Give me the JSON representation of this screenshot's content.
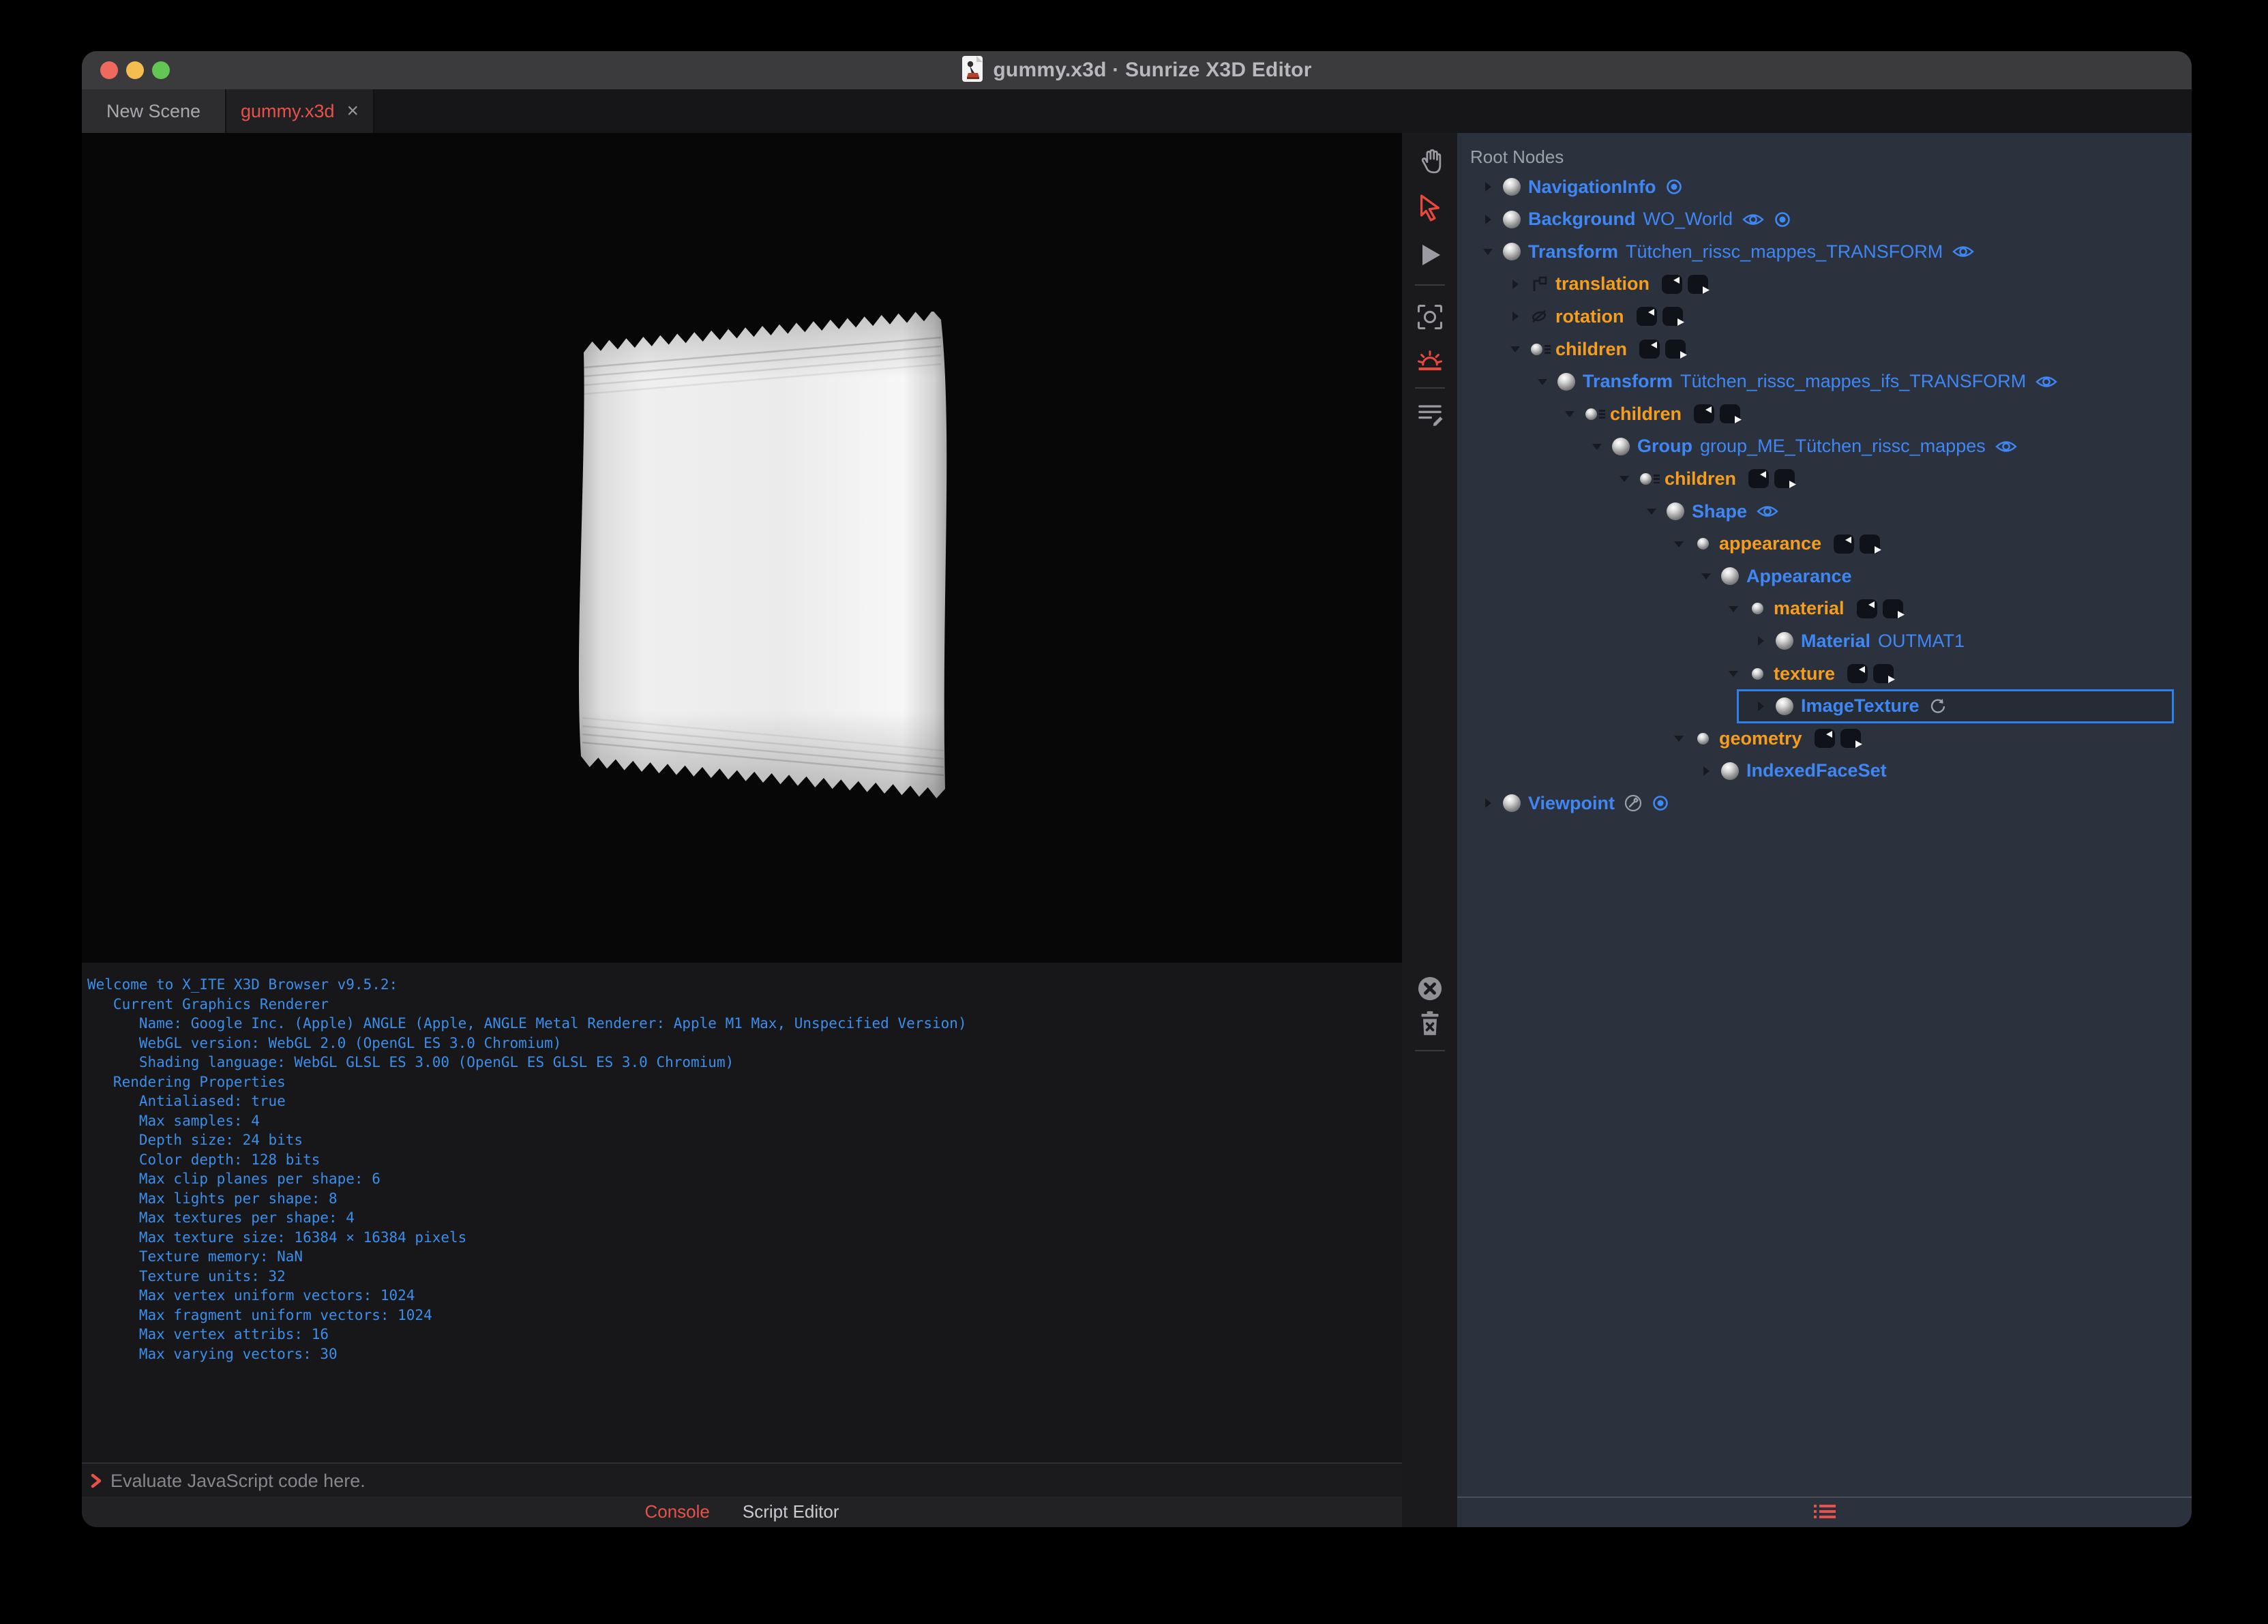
{
  "window": {
    "title": "gummy.x3d · Sunrize X3D Editor",
    "titlebar_icon": "x3d-document-icon",
    "traffic_lights": [
      "close",
      "minimize",
      "zoom"
    ]
  },
  "tabs": [
    {
      "label": "New Scene",
      "active": false
    },
    {
      "label": "gummy.x3d",
      "active": true,
      "close_label": "×"
    }
  ],
  "viewport_toolbar": {
    "top_icons": [
      {
        "name": "pan-hand-icon",
        "active": false
      },
      {
        "name": "select-arrow-icon",
        "active": true
      },
      {
        "name": "play-icon",
        "active": false
      },
      {
        "name": "divider"
      },
      {
        "name": "snapshot-icon",
        "active": false
      },
      {
        "name": "sunrise-icon",
        "active": true
      },
      {
        "name": "divider"
      },
      {
        "name": "script-edit-icon",
        "active": false
      }
    ],
    "console_icons": [
      {
        "name": "clear-circle-x-icon",
        "active": false
      },
      {
        "name": "trash-icon",
        "active": false
      },
      {
        "name": "divider"
      }
    ]
  },
  "console": {
    "lines": [
      "Welcome to X_ITE X3D Browser v9.5.2:",
      "   Current Graphics Renderer",
      "      Name: Google Inc. (Apple) ANGLE (Apple, ANGLE Metal Renderer: Apple M1 Max, Unspecified Version)",
      "      WebGL version: WebGL 2.0 (OpenGL ES 3.0 Chromium)",
      "      Shading language: WebGL GLSL ES 3.00 (OpenGL ES GLSL ES 3.0 Chromium)",
      "   Rendering Properties",
      "      Antialiased: true",
      "      Max samples: 4",
      "      Depth size: 24 bits",
      "      Color depth: 128 bits",
      "      Max clip planes per shape: 6",
      "      Max lights per shape: 8",
      "      Max textures per shape: 4",
      "      Max texture size: 16384 × 16384 pixels",
      "      Texture memory: NaN",
      "      Texture units: 32",
      "      Max vertex uniform vectors: 1024",
      "      Max fragment uniform vectors: 1024",
      "      Max vertex attribs: 16",
      "      Max varying vectors: 30"
    ],
    "prompt_placeholder": "Evaluate JavaScript code here.",
    "tabs": [
      {
        "label": "Console",
        "active": true
      },
      {
        "label": "Script Editor",
        "active": false
      }
    ]
  },
  "outline": {
    "header": "Root Nodes",
    "rows": [
      {
        "level": 0,
        "expander": "collapsed",
        "icon": "node-sphere",
        "type": "NavigationInfo",
        "name": "",
        "badges": [
          "bind"
        ]
      },
      {
        "level": 0,
        "expander": "collapsed",
        "icon": "node-sphere",
        "type": "Background",
        "name": "WO_World",
        "badges": [
          "eye",
          "bind"
        ]
      },
      {
        "level": 0,
        "expander": "expanded",
        "icon": "node-sphere",
        "type": "Transform",
        "name": "Tütchen_rissc_mappes_TRANSFORM",
        "badges": [
          "eye"
        ]
      },
      {
        "level": 1,
        "expander": "collapsed",
        "icon": "field-translation",
        "field": "translation",
        "routes": true
      },
      {
        "level": 1,
        "expander": "collapsed",
        "icon": "field-rotation",
        "field": "rotation",
        "routes": true
      },
      {
        "level": 1,
        "expander": "expanded",
        "icon": "field-mfnode",
        "field": "children",
        "routes": true
      },
      {
        "level": 2,
        "expander": "expanded",
        "icon": "node-sphere",
        "type": "Transform",
        "name": "Tütchen_rissc_mappes_ifs_TRANSFORM",
        "badges": [
          "eye"
        ]
      },
      {
        "level": 3,
        "expander": "expanded",
        "icon": "field-mfnode",
        "field": "children",
        "routes": true
      },
      {
        "level": 4,
        "expander": "expanded",
        "icon": "node-sphere",
        "type": "Group",
        "name": "group_ME_Tütchen_rissc_mappes",
        "badges": [
          "eye"
        ]
      },
      {
        "level": 5,
        "expander": "expanded",
        "icon": "field-mfnode",
        "field": "children",
        "routes": true
      },
      {
        "level": 6,
        "expander": "expanded",
        "icon": "node-sphere",
        "type": "Shape",
        "name": "",
        "badges": [
          "eye"
        ]
      },
      {
        "level": 7,
        "expander": "expanded",
        "icon": "field-sfnode",
        "field": "appearance",
        "routes": true
      },
      {
        "level": 8,
        "expander": "expanded",
        "icon": "node-sphere",
        "type": "Appearance",
        "name": ""
      },
      {
        "level": 9,
        "expander": "expanded",
        "icon": "field-sfnode",
        "field": "material",
        "routes": true
      },
      {
        "level": 10,
        "expander": "collapsed",
        "icon": "node-sphere",
        "type": "Material",
        "name": "OUTMAT1"
      },
      {
        "level": 9,
        "expander": "expanded",
        "icon": "field-sfnode",
        "field": "texture",
        "routes": true
      },
      {
        "level": 10,
        "expander": "collapsed",
        "icon": "node-sphere",
        "type": "ImageTexture",
        "name": "",
        "badges": [
          "refresh"
        ],
        "selected": true
      },
      {
        "level": 7,
        "expander": "expanded",
        "icon": "field-sfnode",
        "field": "geometry",
        "routes": true
      },
      {
        "level": 8,
        "expander": "collapsed",
        "icon": "node-sphere",
        "type": "IndexedFaceSet",
        "name": ""
      },
      {
        "level": 0,
        "expander": "collapsed",
        "icon": "node-sphere",
        "type": "Viewpoint",
        "name": "",
        "badges": [
          "wrench",
          "bind"
        ]
      }
    ],
    "footer_icon": "list-icon"
  },
  "colors": {
    "accent_red": "#e8514a",
    "node_blue": "#3f87f5",
    "field_orange": "#f59d1c",
    "console_blue": "#3b8eea",
    "selection_blue": "#2f80ed",
    "panel_bg": "#2b323e",
    "icon_gray": "#9a9aa0"
  }
}
